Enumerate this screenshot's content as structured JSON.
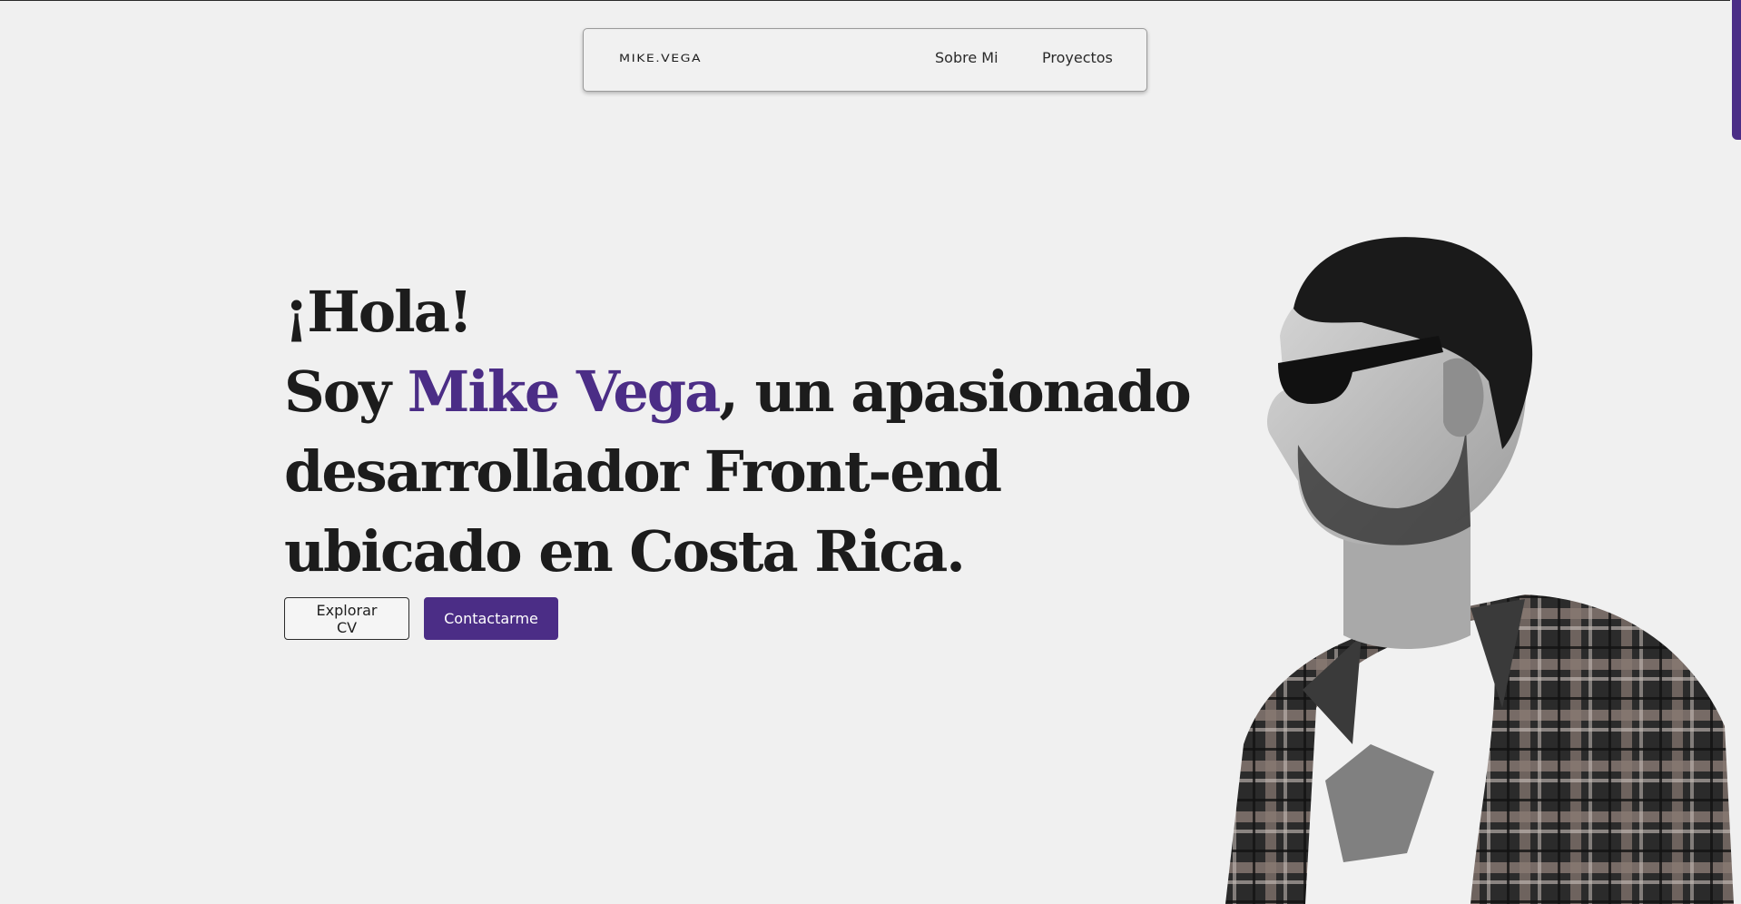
{
  "navbar": {
    "brand": "MIKE.VEGA",
    "links": [
      {
        "label": "Sobre Mi"
      },
      {
        "label": "Proyectos"
      }
    ]
  },
  "hero": {
    "greeting": "¡Hola!",
    "intro_prefix": "Soy ",
    "name": "Mike Vega",
    "intro_suffix": ", un apasionado",
    "line_2": "desarrollador Front-end",
    "line_3": "ubicado en Costa Rica."
  },
  "actions": {
    "cv_label": "Explorar CV",
    "contact_label": "Contactarme"
  },
  "colors": {
    "accent": "#4b2d86",
    "background": "#f0f0f0",
    "text": "#1c1c1c"
  }
}
